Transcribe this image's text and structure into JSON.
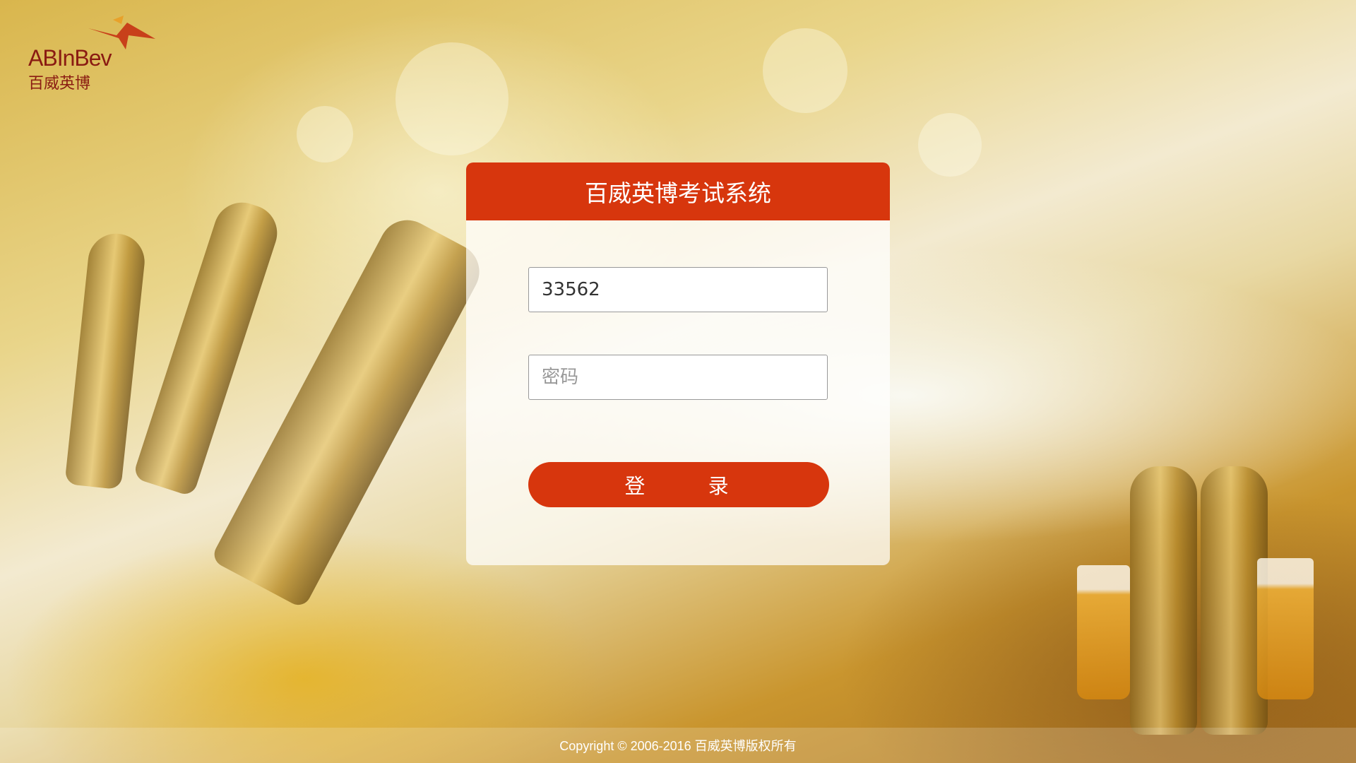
{
  "logo": {
    "brand_text": "ABInBev",
    "brand_cn": "百威英博"
  },
  "login": {
    "title": "百威英博考试系统",
    "username_value": "33562",
    "password_placeholder": "密码",
    "submit_label": "登 录"
  },
  "footer": {
    "copyright": "Copyright © 2006-2016 百威英博版权所有"
  },
  "colors": {
    "accent": "#d7360d",
    "input_border": "#999999",
    "input_text": "#333333"
  }
}
